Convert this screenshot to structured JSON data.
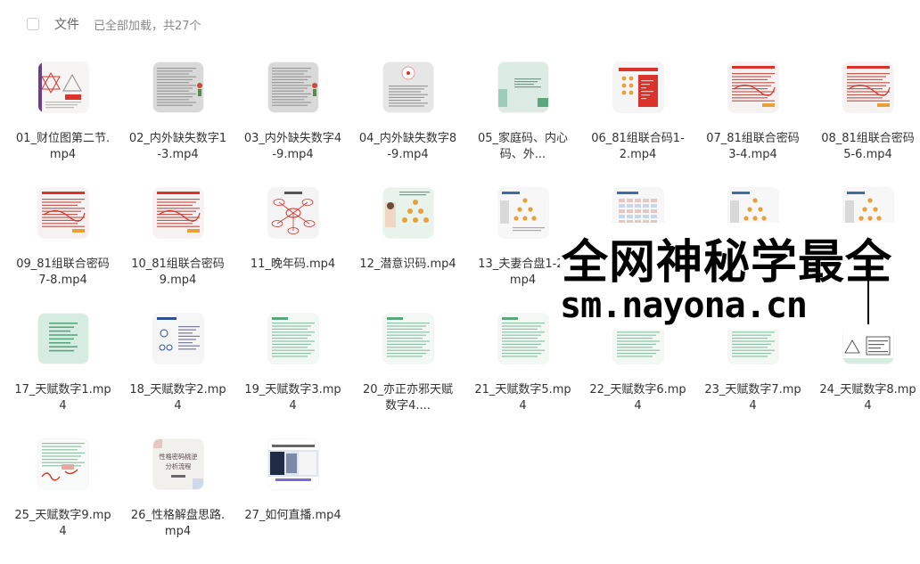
{
  "header": {
    "files_label": "文件",
    "status_text": "已全部加载，共27个"
  },
  "files": [
    {
      "name": "01_财位图第二节.mp4",
      "thumb": "diagram-red"
    },
    {
      "name": "02_内外缺失数字1-3.mp4",
      "thumb": "text-gray"
    },
    {
      "name": "03_内外缺失数字4-9.mp4",
      "thumb": "text-gray"
    },
    {
      "name": "04_内外缺失数字8-9.mp4",
      "thumb": "text-light"
    },
    {
      "name": "05_家庭码、内心码、外...",
      "thumb": "green-slide"
    },
    {
      "name": "06_81组联合码1-2.mp4",
      "thumb": "red-slide"
    },
    {
      "name": "07_81组联合密码3-4.mp4",
      "thumb": "red-notes"
    },
    {
      "name": "08_81组联合密码5-6.mp4",
      "thumb": "red-notes"
    },
    {
      "name": "09_81组联合密码7-8.mp4",
      "thumb": "red-notes"
    },
    {
      "name": "10_81组联合密码9.mp4",
      "thumb": "red-notes"
    },
    {
      "name": "11_晚年码.mp4",
      "thumb": "mindmap"
    },
    {
      "name": "12_潜意识码.mp4",
      "thumb": "pyramid-green"
    },
    {
      "name": "13_夫妻合盘1-2.mp4",
      "thumb": "couple-chart"
    },
    {
      "name": "",
      "thumb": "table-blue"
    },
    {
      "name": "",
      "thumb": "couple-chart"
    },
    {
      "name": "",
      "thumb": "couple-chart"
    },
    {
      "name": "17_天赋数字1.mp4",
      "thumb": "green-list"
    },
    {
      "name": "18_天赋数字2.mp4",
      "thumb": "blue-diagram"
    },
    {
      "name": "19_天赋数字3.mp4",
      "thumb": "green-text"
    },
    {
      "name": "20_亦正亦邪天赋数字4....",
      "thumb": "green-text"
    },
    {
      "name": "21_天赋数字5.mp4",
      "thumb": "green-text"
    },
    {
      "name": "22_天赋数字6.mp4",
      "thumb": "green-text"
    },
    {
      "name": "23_天赋数字7.mp4",
      "thumb": "green-text"
    },
    {
      "name": "24_天赋数字8.mp4",
      "thumb": "pyramid-gray"
    },
    {
      "name": "25_天赋数字9.mp4",
      "thumb": "red-handwrite"
    },
    {
      "name": "26_性格解盘思路.mp4",
      "thumb": "cover-text",
      "cover_text": "性格密码桃逆分析流程"
    },
    {
      "name": "27_如何直播.mp4",
      "thumb": "screen"
    }
  ],
  "watermark": {
    "line1": "全网神秘学最全",
    "line2": "sm.nayona.cn"
  },
  "colors": {
    "background": "#ffffff",
    "text": "#333333",
    "muted": "#888888",
    "accent_red": "#d9332b",
    "accent_green": "#5aa77f"
  }
}
